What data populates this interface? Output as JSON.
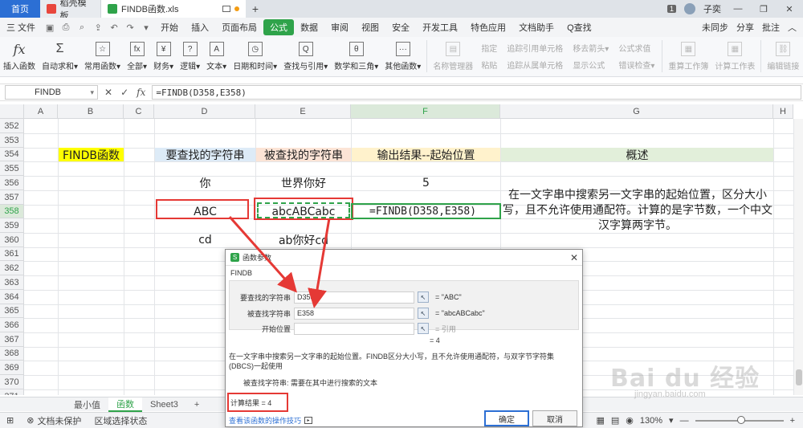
{
  "titlebar": {
    "tabs": [
      {
        "label": "首页"
      },
      {
        "label": "稻壳模板"
      },
      {
        "label": "FINDB函数.xls"
      }
    ],
    "badge": "1",
    "user": "子奕"
  },
  "menubar": {
    "file": "三 文件",
    "items": [
      "开始",
      "插入",
      "页面布局",
      "公式",
      "数据",
      "审阅",
      "视图",
      "安全",
      "开发工具",
      "特色应用",
      "文档助手",
      "Q查找"
    ],
    "active": "公式",
    "sync": "未同步",
    "share": "分享",
    "annotate": "批注"
  },
  "ribbon": {
    "buttons": [
      {
        "label": "插入函数",
        "glyph": "fx"
      },
      {
        "label": "自动求和▾",
        "glyph": "Σ"
      },
      {
        "label": "常用函数▾",
        "glyph": "☆"
      },
      {
        "label": "全部▾",
        "glyph": "fx"
      },
      {
        "label": "财务▾",
        "glyph": "¥"
      },
      {
        "label": "逻辑▾",
        "glyph": "?"
      },
      {
        "label": "文本▾",
        "glyph": "A"
      },
      {
        "label": "日期和时间▾",
        "glyph": "◷"
      },
      {
        "label": "查找与引用▾",
        "glyph": "Q"
      },
      {
        "label": "数学和三角▾",
        "glyph": "θ"
      },
      {
        "label": "其他函数▾",
        "glyph": "···"
      }
    ],
    "name_manager": "名称管理器",
    "col1": [
      "指定",
      "粘贴"
    ],
    "col2": [
      "追踪引用单元格",
      "追踪从属单元格"
    ],
    "col3": [
      "移去箭头▾",
      "显示公式"
    ],
    "col4": [
      "公式求值",
      "错误检查▾"
    ],
    "calc_sheet": "重算工作簿",
    "calc_work": "计算工作表",
    "edit_link": "编辑链接"
  },
  "formulabar": {
    "cell_ref": "FINDB",
    "formula": "=FINDB(D358,E358)"
  },
  "grid": {
    "columns": [
      "A",
      "B",
      "C",
      "D",
      "E",
      "F",
      "G",
      "H"
    ],
    "rows": [
      "352",
      "353",
      "354",
      "355",
      "356",
      "357",
      "358",
      "359",
      "360",
      "361",
      "362",
      "363",
      "364",
      "365",
      "366",
      "367",
      "368",
      "369",
      "370",
      "371"
    ],
    "selected_col": "F",
    "selected_row": "358",
    "cells": {
      "b354": "FINDB函数",
      "d354": "要查找的字符串",
      "e354": "被查找的字符串",
      "f354": "输出结果--起始位置",
      "g354": "概述",
      "d356": "你",
      "e356": "世界你好",
      "f356": "5",
      "d358": "ABC",
      "e358": "abcABCabc",
      "f358": "=FINDB(D358,E358)",
      "d360": "cd",
      "e360": "ab你好cd"
    },
    "description": "在一文字串中搜索另一文字串的起始位置，区分大小写，且不允许使用通配符。计算的是字节数，一个中文汉字算两字节。"
  },
  "dialog": {
    "title": "函数参数",
    "function_name": "FINDB",
    "args": [
      {
        "label": "要查找的字符串",
        "value": "D358",
        "result": "= \"ABC\""
      },
      {
        "label": "被查找字符串",
        "value": "E358",
        "result": "= \"abcABCabc\""
      },
      {
        "label": "开始位置",
        "value": "",
        "result": "= 引用"
      }
    ],
    "result_mid": "= 4",
    "description": "在一文字串中搜索另一文字串的起始位置。FINDB区分大小写，且不允许使用通配符，与双字节字符集(DBCS)一起使用",
    "param_help": "被查找字符串:   需要在其中进行搜索的文本",
    "calc_result": "计算结果  =  4",
    "help_link": "查看该函数的操作技巧",
    "ok": "确定",
    "cancel": "取消"
  },
  "sheets": {
    "tabs": [
      "最小值",
      "函数",
      "Sheet3"
    ],
    "active": "函数"
  },
  "statusbar": {
    "protect": "文档未保护",
    "mode": "区域选择状态",
    "zoom": "130%"
  },
  "watermark": {
    "logo": "Bai du 经验",
    "url": "jingyan.baidu.com"
  },
  "colors": {
    "accent": "#2fa34a",
    "annotation": "#e53935"
  }
}
